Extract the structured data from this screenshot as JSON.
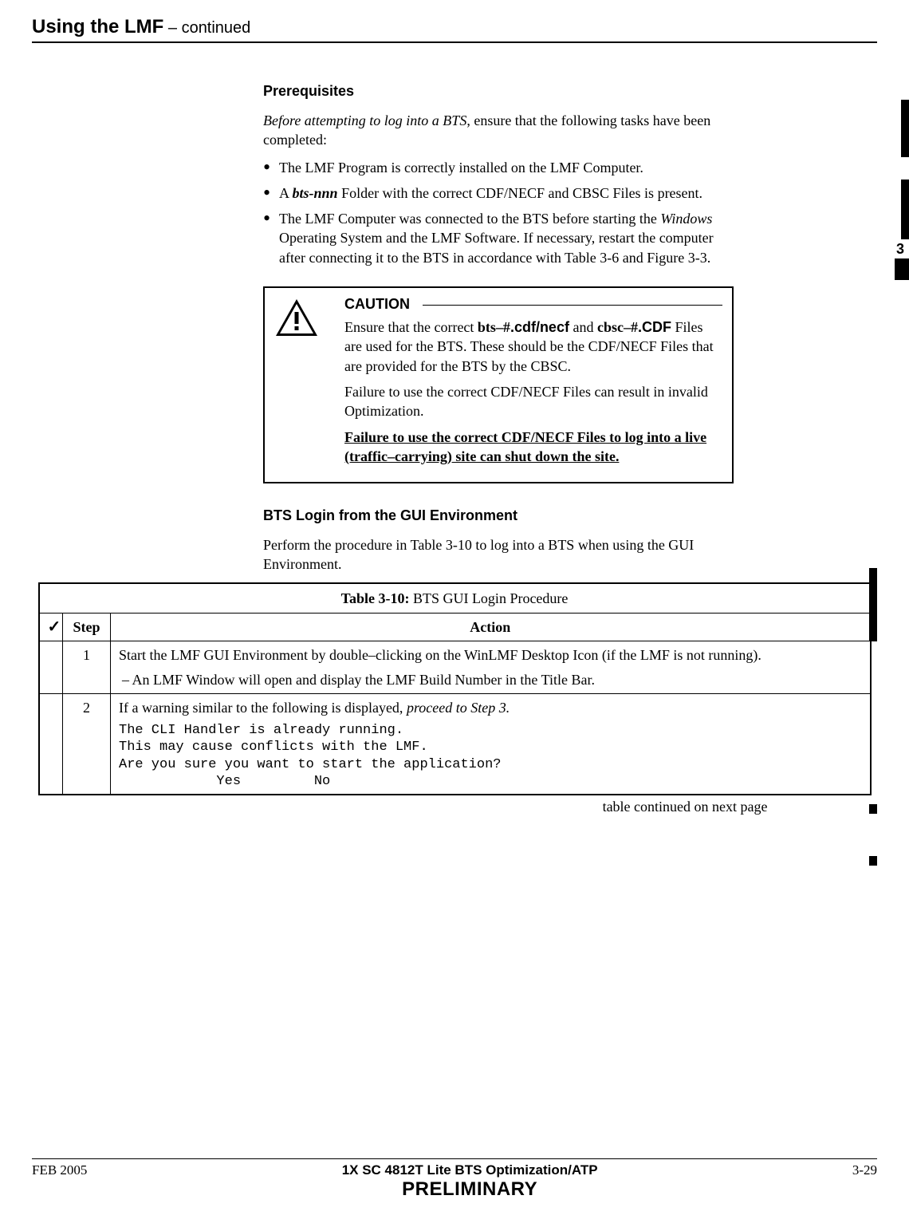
{
  "header": {
    "title_main": "Using the LMF",
    "title_cont": " – continued"
  },
  "side_tab_number": "3",
  "prereq": {
    "heading": "Prerequisites",
    "intro_italic": "Before attempting to log into a BTS",
    "intro_rest": ", ensure that the following tasks have been completed:",
    "b1": "The LMF Program is correctly installed on the LMF Computer.",
    "b2_a": "A ",
    "b2_bi": "bts-nnn",
    "b2_c": " Folder with the correct CDF/NECF and CBSC Files is present.",
    "b3_a": "The LMF Computer was connected to the BTS before starting the ",
    "b3_i": "Windows",
    "b3_c": " Operating System and the LMF Software. If necessary, restart the computer after connecting it to the BTS in accordance with Table 3-6 and Figure 3-3."
  },
  "caution": {
    "title": "CAUTION",
    "p1_a": "Ensure that the correct ",
    "p1_b1": "bts–#",
    "p1_b2": ".cdf/necf",
    "p1_c": " and ",
    "p1_d1": "cbsc–#",
    "p1_d2": ".CDF",
    "p1_e": " Files are used for the BTS. These should be the CDF/NECF Files that are provided for the BTS by the CBSC.",
    "p2": "Failure to use the correct CDF/NECF Files can result in invalid Optimization.",
    "p3": "Failure to use the correct CDF/NECF Files to log into a live (traffic–carrying) site can shut down the site."
  },
  "section2": {
    "heading": "BTS Login from the GUI Environment",
    "intro": "Perform the procedure in Table 3-10 to log into a BTS when using the GUI Environment."
  },
  "table": {
    "caption_bold": "Table 3-10:",
    "caption_rest": " BTS GUI Login Procedure",
    "check_glyph": "✓",
    "h_step": "Step",
    "h_action": "Action",
    "r1_step": "1",
    "r1_a": "Start the LMF GUI Environment by double–clicking on the WinLMF Desktop Icon (if the LMF is not running).",
    "r1_sub": "–  An LMF Window will open and display the LMF Build Number in the Title Bar.",
    "r2_step": "2",
    "r2_a_a": "If a warning similar to the following is displayed, ",
    "r2_a_i": "proceed to Step 3.",
    "r2_mono": "The CLI Handler is already running.\nThis may cause conflicts with the LMF.\nAre you sure you want to start the application?\n            Yes         No",
    "continued": "table continued on next page"
  },
  "footer": {
    "left": "FEB 2005",
    "center_doc": "1X SC 4812T Lite BTS Optimization/ATP",
    "center_prelim": "PRELIMINARY",
    "right": "3-29"
  }
}
